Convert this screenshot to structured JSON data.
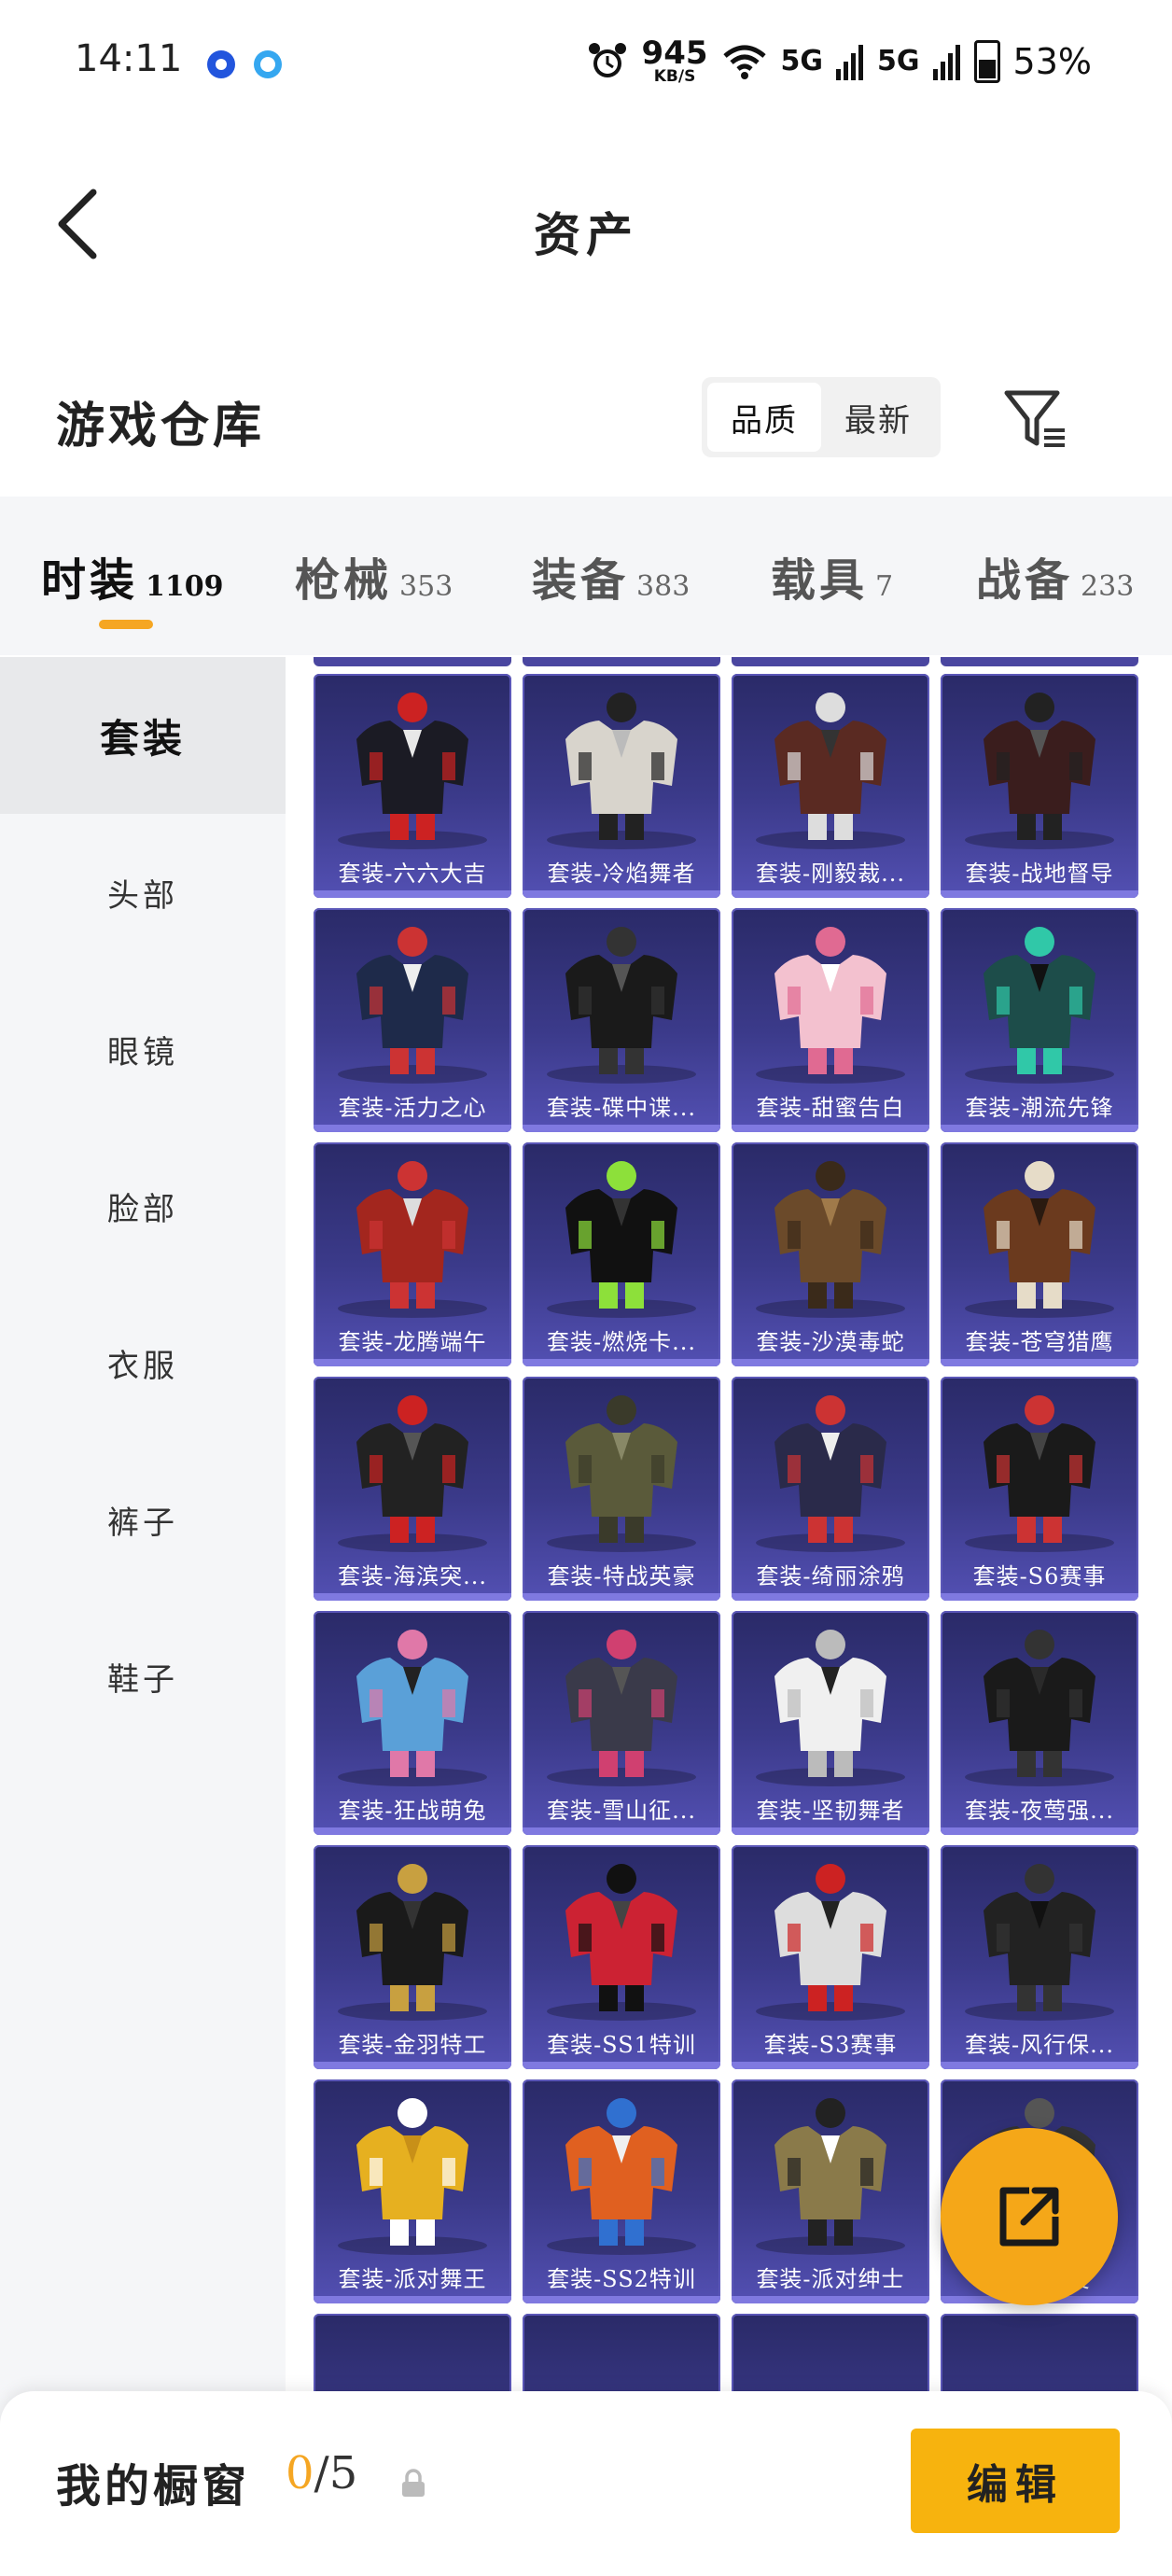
{
  "status_bar": {
    "time": "14:11",
    "net_speed": "945",
    "net_unit": "KB/S",
    "signal1": "5G",
    "signal2": "5G",
    "battery": "53%"
  },
  "nav": {
    "title": "资产"
  },
  "warehouse": {
    "title": "游戏仓库",
    "sort_options": [
      "品质",
      "最新"
    ],
    "active_sort": "品质"
  },
  "category_tabs": [
    {
      "label": "时装",
      "count": "1109",
      "active": true
    },
    {
      "label": "枪械",
      "count": "353"
    },
    {
      "label": "装备",
      "count": "383"
    },
    {
      "label": "载具",
      "count": "7"
    },
    {
      "label": "战备",
      "count": "233"
    }
  ],
  "sidebar": {
    "items": [
      {
        "label": "套装",
        "active": true
      },
      {
        "label": "头部"
      },
      {
        "label": "眼镜"
      },
      {
        "label": "脸部"
      },
      {
        "label": "衣服"
      },
      {
        "label": "裤子"
      },
      {
        "label": "鞋子"
      }
    ]
  },
  "items": [
    "套装-六六大吉",
    "套装-冷焰舞者",
    "套装-刚毅裁...",
    "套装-战地督导",
    "套装-活力之心",
    "套装-碟中谍...",
    "套装-甜蜜告白",
    "套装-潮流先锋",
    "套装-龙腾端午",
    "套装-燃烧卡...",
    "套装-沙漠毒蛇",
    "套装-苍穹猎鹰",
    "套装-海滨突...",
    "套装-特战英豪",
    "套装-绮丽涂鸦",
    "套装-S6赛事",
    "套装-狂战萌兔",
    "套装-雪山征...",
    "套装-坚韧舞者",
    "套装-夜莺强...",
    "套装-金羽特工",
    "套装-SS1特训",
    "套装-S3赛事",
    "套装-风行保...",
    "套装-派对舞王",
    "套装-SS2特训",
    "套装-派对绅士",
    "套装-精英"
  ],
  "bottom": {
    "showcase_label": "我的橱窗",
    "showcase_current": "0",
    "showcase_total": "/5",
    "edit_label": "编辑"
  },
  "colors": {
    "accent": "#f5a623",
    "card_bg_top": "#2a2a68",
    "card_bg_bottom": "#5350b3",
    "edit_button": "#f7b30e"
  }
}
